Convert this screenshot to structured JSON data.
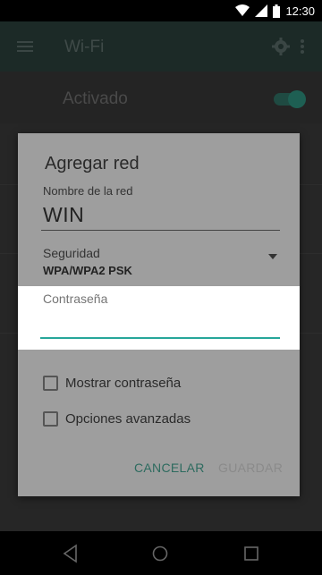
{
  "status_bar": {
    "time": "12:30",
    "icons": [
      "wifi-icon",
      "signal-icon",
      "battery-icon"
    ]
  },
  "app_bar": {
    "title": "Wi-Fi",
    "icons": [
      "menu-icon",
      "gear-icon",
      "overflow-icon"
    ]
  },
  "switch_bar": {
    "label": "Activado",
    "switch_on": true
  },
  "dialog": {
    "title": "Agregar red",
    "ssid_label": "Nombre de la red",
    "ssid_value": "WIN",
    "security_label": "Seguridad",
    "security_value": "WPA/WPA2 PSK",
    "password_label": "Contraseña",
    "password_value": "",
    "show_password_label": "Mostrar contraseña",
    "advanced_options_label": "Opciones avanzadas",
    "cancel_label": "CANCELAR",
    "save_label": "GUARDAR"
  },
  "nav_bar": {
    "icons": [
      "back-icon",
      "home-icon",
      "recents-icon"
    ]
  },
  "colors": {
    "accent": "#26a69a",
    "cancel_text": "#2d6b5f",
    "dialog_dimmed": "#9e9e9e"
  }
}
